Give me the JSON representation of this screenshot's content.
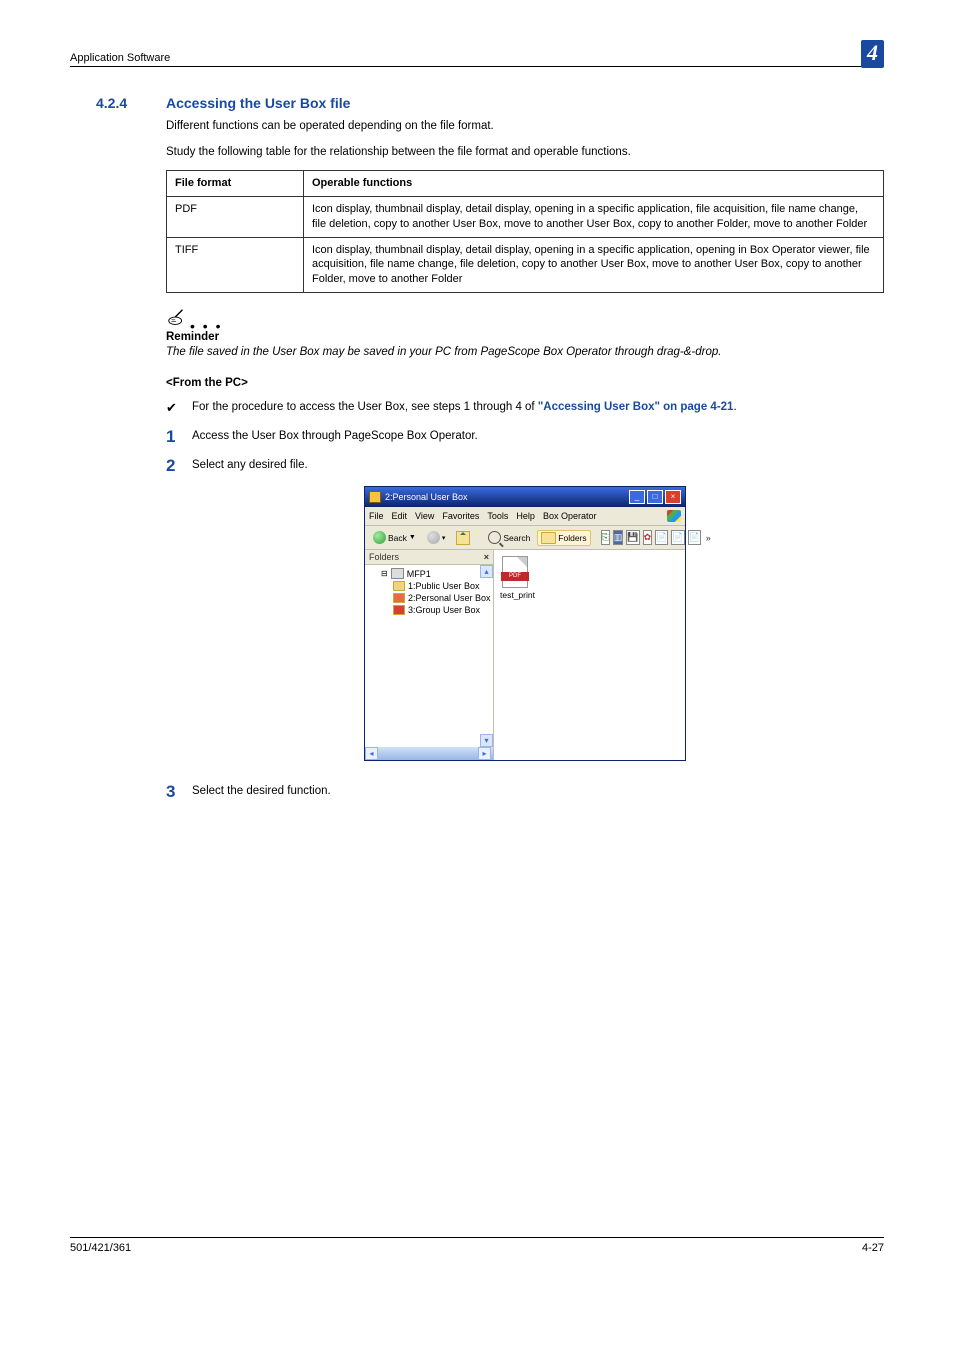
{
  "header": {
    "running_title": "Application Software",
    "chapter_number": "4"
  },
  "section": {
    "number": "4.2.4",
    "title": "Accessing the User Box file",
    "intro_p1": "Different functions can be operated depending on the file format.",
    "intro_p2": "Study the following table for the relationship between the file format and operable functions."
  },
  "table": {
    "headers": {
      "col1": "File format",
      "col2": "Operable functions"
    },
    "rows": [
      {
        "format": "PDF",
        "functions": "Icon display, thumbnail display, detail display, opening in a specific application, file acquisition, file name change, file deletion, copy to another User Box, move to another User Box, copy to another Folder, move to another Folder"
      },
      {
        "format": "TIFF",
        "functions": "Icon display, thumbnail display, detail display, opening in a specific application, opening in Box Operator viewer, file acquisition, file name change, file deletion, copy to another User Box, move to another User Box, copy to another Folder, move to another Folder"
      }
    ]
  },
  "reminder": {
    "heading": "Reminder",
    "body": "The file saved in the User Box may be saved in your PC from PageScope Box Operator through drag-&-drop."
  },
  "from_pc": {
    "heading": "<From the PC>",
    "bullet_prefix": "For the procedure to access the User Box, see steps 1 through 4 of ",
    "bullet_link": "\"Accessing User Box\" on page 4-21",
    "bullet_suffix": ".",
    "steps": {
      "s1": "Access the User Box through PageScope Box Operator.",
      "s2": "Select any desired file.",
      "s3": "Select the desired function."
    }
  },
  "screenshot": {
    "title": "2:Personal User Box",
    "menus": [
      "File",
      "Edit",
      "View",
      "Favorites",
      "Tools",
      "Help",
      "Box Operator"
    ],
    "toolbar": {
      "back": "Back",
      "search": "Search",
      "folders": "Folders"
    },
    "folders_title": "Folders",
    "tree": {
      "device": "MFP1",
      "n1": "1:Public User Box",
      "n2": "2:Personal User Box",
      "n3": "3:Group User Box"
    },
    "file_label": "test_print",
    "pdf_band": "PDF"
  },
  "footer": {
    "left": "501/421/361",
    "right": "4-27"
  }
}
